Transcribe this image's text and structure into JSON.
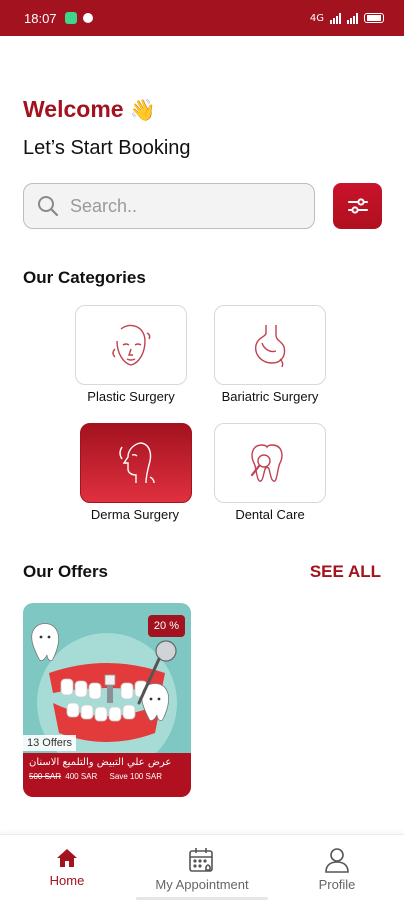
{
  "status_bar": {
    "time": "18:07",
    "network": "4G"
  },
  "header": {
    "welcome": "Welcome",
    "wave_emoji": "👋",
    "subtitle": "Let’s Start Booking"
  },
  "search": {
    "placeholder": "Search.."
  },
  "categories": {
    "title": "Our Categories",
    "items": [
      {
        "label": "Plastic Surgery",
        "icon": "face-icon",
        "selected": false
      },
      {
        "label": "Bariatric Surgery",
        "icon": "stomach-icon",
        "selected": false
      },
      {
        "label": "Derma Surgery",
        "icon": "profile-face-icon",
        "selected": true
      },
      {
        "label": "Dental Care",
        "icon": "tooth-magnifier-icon",
        "selected": false
      }
    ]
  },
  "offers": {
    "title": "Our Offers",
    "see_all": "SEE ALL",
    "items": [
      {
        "discount": "20 %",
        "count": "13 Offers",
        "title": "عرض علي التبيض والتلميع الاسنان",
        "old_price": "500 SAR",
        "new_price": "400 SAR",
        "save": "Save 100 SAR"
      }
    ]
  },
  "bottom_nav": {
    "items": [
      {
        "label": "Home",
        "icon": "home-icon",
        "active": true
      },
      {
        "label": "My Appointment",
        "icon": "calendar-icon",
        "active": false
      },
      {
        "label": "Profile",
        "icon": "user-icon",
        "active": false
      }
    ]
  },
  "colors": {
    "brand": "#a3121f",
    "brand_light": "#e0303f"
  }
}
